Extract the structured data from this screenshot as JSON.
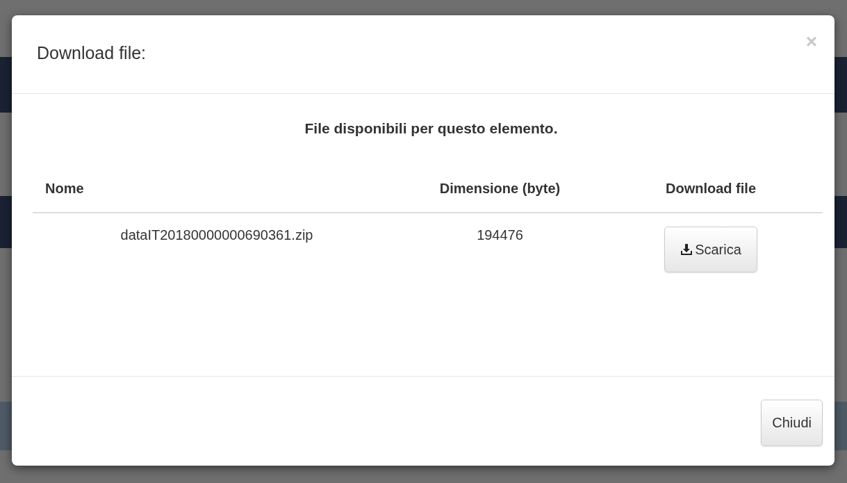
{
  "dialog": {
    "title": "Download file:",
    "close_label": "×",
    "heading": "File disponibili per questo elemento.",
    "table": {
      "columns": [
        "Nome",
        "Dimensione (byte)",
        "Download file"
      ],
      "rows": [
        {
          "name": "dataIT20180000000690361.zip",
          "size": "194476",
          "action": "Scarica"
        }
      ]
    },
    "buttons": [
      "Chiudi"
    ]
  }
}
